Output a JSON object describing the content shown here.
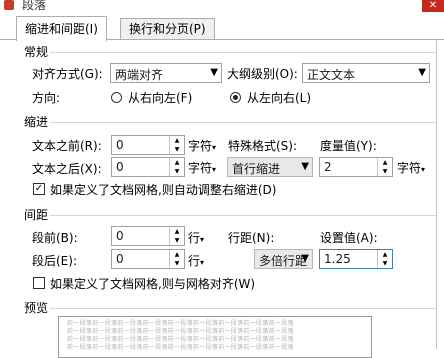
{
  "window": {
    "title": "段落",
    "close_glyph": "✕"
  },
  "tabs": [
    {
      "label": "缩进和间距(I)",
      "active": true
    },
    {
      "label": "换行和分页(P)",
      "active": false
    }
  ],
  "general": {
    "section_title": "常规",
    "alignment_label": "对齐方式(G):",
    "alignment_value": "两端对齐",
    "outline_label": "大纲级别(O):",
    "outline_value": "正文文本",
    "direction_label": "方向:",
    "rtl_label": "从右向左(F)",
    "ltr_label": "从左向右(L)",
    "selected_direction": "ltr"
  },
  "indent": {
    "section_title": "缩进",
    "before_label": "文本之前(R):",
    "before_value": "0",
    "before_unit": "字符",
    "after_label": "文本之后(X):",
    "after_value": "0",
    "after_unit": "字符",
    "special_label": "特殊格式(S):",
    "special_value": "首行缩进",
    "measure_label": "度量值(Y):",
    "measure_value": "2",
    "measure_unit": "字符",
    "grid_check_label": "如果定义了文档网格,则自动调整右缩进(D)",
    "grid_checked": true
  },
  "spacing": {
    "section_title": "间距",
    "before_label": "段前(B):",
    "before_value": "0",
    "before_unit": "行",
    "after_label": "段后(E):",
    "after_value": "0",
    "after_unit": "行",
    "line_label": "行距(N):",
    "line_value": "多倍行距",
    "setting_label": "设置值(A):",
    "setting_value": "1.25",
    "grid_check_label": "如果定义了文档网格,则与网格对齐(W)",
    "grid_checked": false
  },
  "preview": {
    "section_title": "预览",
    "lines": [
      "前一段落前一段落前一段落前一段落前一段落前一段落前一段落前一段落前一段落",
      "前一段落前一段落前一段落前一段落前一段落前一段落前一段落前一段落前一段落",
      "前一段落前一段落前一段落前一段落前一段落前一段落前一段落前一段落前一段落",
      "前一段落前一段落前一段落前一段落前一段落前一段落前一段落前一段落前一段落"
    ]
  }
}
